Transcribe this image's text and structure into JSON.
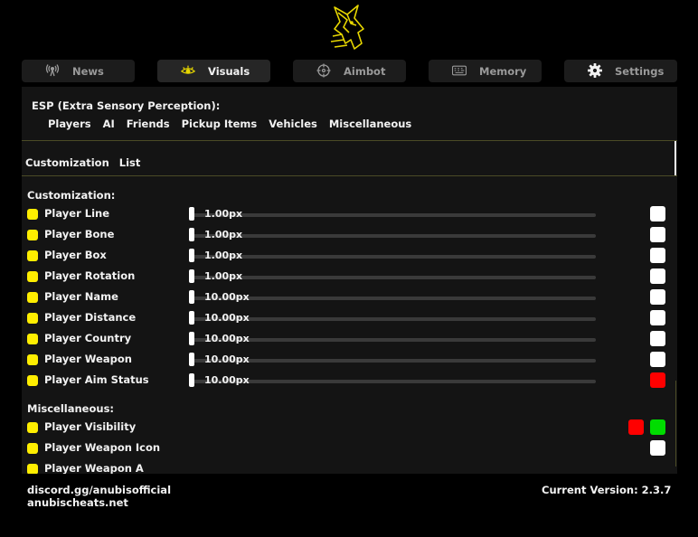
{
  "app": {
    "logo_icon": "anubis-jackal-logo",
    "accent_color": "#ffee00"
  },
  "tabs": [
    {
      "label": "News",
      "icon": "broadcast-icon"
    },
    {
      "label": "Visuals",
      "icon": "eye-icon",
      "active": true
    },
    {
      "label": "Aimbot",
      "icon": "crosshair-icon"
    },
    {
      "label": "Memory",
      "icon": "keyboard-icon"
    },
    {
      "label": "Settings",
      "icon": "gear-icon"
    }
  ],
  "esp": {
    "title": "ESP (Extra Sensory Perception):",
    "subtabs": [
      "Players",
      "AI",
      "Friends",
      "Pickup Items",
      "Vehicles",
      "Miscellaneous"
    ]
  },
  "modes": [
    "Customization",
    "List"
  ],
  "customization": {
    "heading": "Customization:",
    "rows": [
      {
        "label": "Player Line",
        "value": "1.00px",
        "color": "#ffffff"
      },
      {
        "label": "Player Bone",
        "value": "1.00px",
        "color": "#ffffff"
      },
      {
        "label": "Player Box",
        "value": "1.00px",
        "color": "#ffffff"
      },
      {
        "label": "Player Rotation",
        "value": "1.00px",
        "color": "#ffffff"
      },
      {
        "label": "Player Name",
        "value": "10.00px",
        "color": "#ffffff"
      },
      {
        "label": "Player Distance",
        "value": "10.00px",
        "color": "#ffffff"
      },
      {
        "label": "Player Country",
        "value": "10.00px",
        "color": "#ffffff"
      },
      {
        "label": "Player Weapon",
        "value": "10.00px",
        "color": "#ffffff"
      },
      {
        "label": "Player Aim Status",
        "value": "10.00px",
        "color": "#ff0000"
      }
    ]
  },
  "miscellaneous": {
    "heading": "Miscellaneous:",
    "rows": [
      {
        "label": "Player Visibility",
        "colors": [
          "#ff0000",
          "#00dd00"
        ]
      },
      {
        "label": "Player Weapon Icon",
        "colors": [
          "#ffffff"
        ]
      },
      {
        "label": "Player Weapon A",
        "colors": []
      }
    ]
  },
  "footer": {
    "discord": "discord.gg/anubisofficial",
    "website": "anubischeats.net",
    "version": "Current Version: 2.3.7"
  }
}
